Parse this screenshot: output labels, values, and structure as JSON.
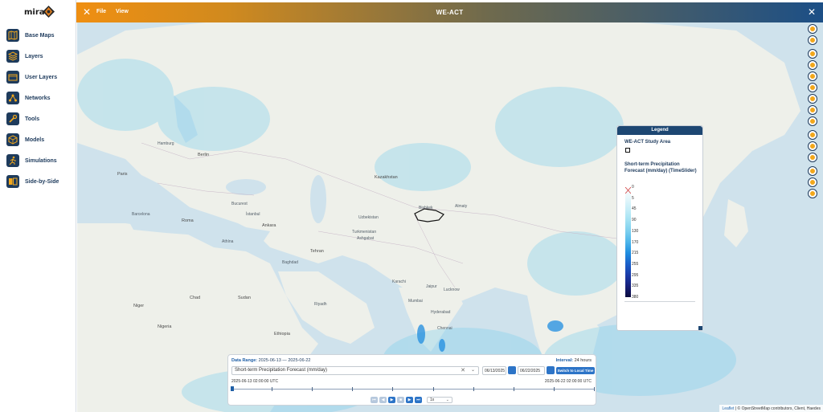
{
  "header": {
    "title": "WE-ACT",
    "menu_file": "File",
    "menu_view": "View",
    "close_left": "✕",
    "close_right": "✕"
  },
  "logo": {
    "text": "mira"
  },
  "sidebar": {
    "items": [
      {
        "label": "Base Maps",
        "icon": "map-icon"
      },
      {
        "label": "Layers",
        "icon": "layers-icon"
      },
      {
        "label": "User Layers",
        "icon": "user-layers-icon"
      },
      {
        "label": "Networks",
        "icon": "network-icon"
      },
      {
        "label": "Tools",
        "icon": "wrench-icon"
      },
      {
        "label": "Models",
        "icon": "cube-icon"
      },
      {
        "label": "Simulations",
        "icon": "runner-icon"
      },
      {
        "label": "Side-by-Side",
        "icon": "side-by-side-icon"
      }
    ]
  },
  "map": {
    "labels": [
      {
        "text": "Hamburg"
      },
      {
        "text": "Berlin"
      },
      {
        "text": "Paris"
      },
      {
        "text": "Barcelona"
      },
      {
        "text": "Roma"
      },
      {
        "text": "Athína"
      },
      {
        "text": "Bucurest"
      },
      {
        "text": "İstanbul"
      },
      {
        "text": "Ankara"
      },
      {
        "text": "Kazakhstan"
      },
      {
        "text": "Uzbekistan"
      },
      {
        "text": "Turkmenistan"
      },
      {
        "text": "Ashgabat"
      },
      {
        "text": "Tehran"
      },
      {
        "text": "Baghdad"
      },
      {
        "text": "Riyadh"
      },
      {
        "text": "Karachi"
      },
      {
        "text": "Jaipur"
      },
      {
        "text": "Lucknow"
      },
      {
        "text": "Hyderabad"
      },
      {
        "text": "Chennai"
      },
      {
        "text": "Mumbai"
      },
      {
        "text": "Niger"
      },
      {
        "text": "Nigeria"
      },
      {
        "text": "Chad"
      },
      {
        "text": "Ethiopia"
      },
      {
        "text": "Sudan"
      },
      {
        "text": "Bishkek"
      },
      {
        "text": "Almaty"
      }
    ]
  },
  "legend": {
    "title": "Legend",
    "layer1": "WE-ACT Study Area",
    "layer2": "Short-term Precipitation Forecast (mm/day) (TimeSlider)",
    "ticks": [
      "0",
      "5",
      "45",
      "90",
      "130",
      "170",
      "215",
      "255",
      "295",
      "335",
      "380"
    ],
    "colors": [
      "#ffffff",
      "#e6f7fb",
      "#c7eef8",
      "#a3e2f3",
      "#7ccfee",
      "#4cb5ea",
      "#1f8de0",
      "#1a5fc9",
      "#1a3ba8",
      "#161f7a",
      "#0b0b3d"
    ]
  },
  "timeslider": {
    "range_label": "Data Range:",
    "range_value": "2025-06-13 — 2025-06-22",
    "interval_label": "Interval:",
    "interval_value": "24 hours",
    "layer_select": "Short-term Precipitation Forecast (mm/day)",
    "start_date": "06/13/2025",
    "end_date": "06/22/2025",
    "switch_label": "Switch to Local Time",
    "start_time": "2025-06-13 02:00:00 UTC",
    "end_time": "2025-06-22 02:00:00 UTC",
    "speed": "1x",
    "tick_count": 10,
    "position": 0
  },
  "attribution": {
    "leaflet": "Leaflet",
    "rest": " | © OpenStreetMap contributors, Client, Haedes"
  },
  "toolbar": {
    "buttons": [
      "zoom-in-icon",
      "zoom-out-icon",
      "locate-icon",
      "pencil-icon",
      "select-icon",
      "ruler-icon",
      "polygon-icon",
      "layers-tool-icon",
      "print-icon",
      "info-icon",
      "measure-icon",
      "export-icon",
      "search-tool-icon",
      "history-icon",
      "help-icon"
    ]
  }
}
